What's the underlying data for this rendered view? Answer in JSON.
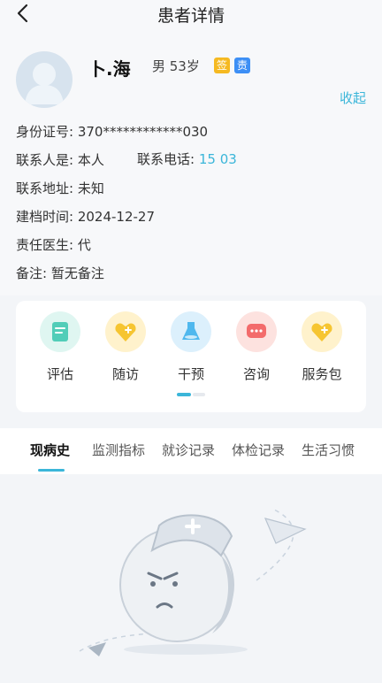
{
  "header": {
    "title": "患者详情"
  },
  "patient": {
    "name": "卜.海",
    "gender_age": "男 53岁",
    "badges": [
      "签",
      "责"
    ],
    "collapse": "收起",
    "id_label": "身份证号:",
    "id_value": "370************030",
    "contact_label": "联系人是:",
    "contact_value": "本人",
    "phone_label": "联系电话:",
    "phone_value": "15        03",
    "address_label": "联系地址:",
    "address_value": "未知",
    "created_label": "建档时间:",
    "created_value": "2024-12-27",
    "doctor_label": "责任医生:",
    "doctor_value": "代",
    "note_label": "备注:",
    "note_value": "暂无备注"
  },
  "actions": [
    {
      "label": "评估",
      "icon": "assessment-icon",
      "color": "#51cdb8"
    },
    {
      "label": "随访",
      "icon": "followup-icon",
      "color": "#f6c531"
    },
    {
      "label": "干预",
      "icon": "intervention-icon",
      "color": "#4fb8ee"
    },
    {
      "label": "咨询",
      "icon": "consult-icon",
      "color": "#f36b6b"
    },
    {
      "label": "服务包",
      "icon": "service-package-icon",
      "color": "#f6c531"
    }
  ],
  "tabs": [
    "现病史",
    "监测指标",
    "就诊记录",
    "体检记录",
    "生活习惯"
  ],
  "colors": {
    "accent": "#3bb6d9",
    "sign_badge": "#f5b921",
    "resp_badge": "#3d8ff5"
  }
}
